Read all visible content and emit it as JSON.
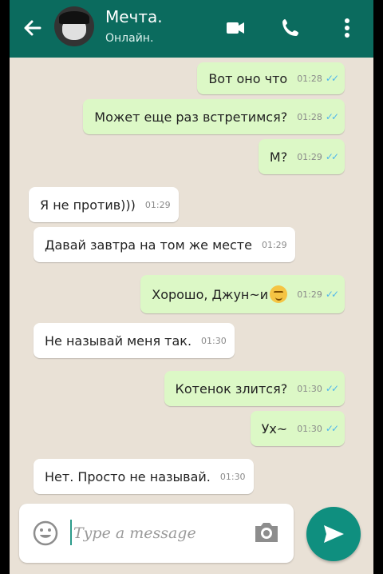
{
  "header": {
    "contact_name": "Мечта.",
    "status": "Онлайн.",
    "colors": {
      "bar": "#0b6b5e",
      "accent": "#0f8f7f"
    }
  },
  "messages": [
    {
      "text": "Вот оно что",
      "time": "01:28",
      "direction": "outgoing",
      "read": true
    },
    {
      "text": "Может еще раз встретимся?",
      "time": "01:28",
      "direction": "outgoing",
      "read": true
    },
    {
      "text": "М?",
      "time": "01:29",
      "direction": "outgoing",
      "read": true
    },
    {
      "text": "Я не против)))",
      "time": "01:29",
      "direction": "incoming"
    },
    {
      "text": "Давай завтра на том же месте",
      "time": "01:29",
      "direction": "incoming"
    },
    {
      "text": "Хорошо, Джун~и",
      "time": "01:29",
      "direction": "outgoing",
      "read": true,
      "emoji": "smirk-emoji"
    },
    {
      "text": "Не называй меня так.",
      "time": "01:30",
      "direction": "incoming"
    },
    {
      "text": "Котенок злится?",
      "time": "01:30",
      "direction": "outgoing",
      "read": true
    },
    {
      "text": "Ух~",
      "time": "01:30",
      "direction": "outgoing",
      "read": true
    },
    {
      "text": "Нет. Просто не называй.",
      "time": "01:30",
      "direction": "incoming"
    }
  ],
  "composer": {
    "placeholder": "Type a message",
    "icons": [
      "emoji-icon",
      "camera-icon",
      "send-icon"
    ]
  }
}
